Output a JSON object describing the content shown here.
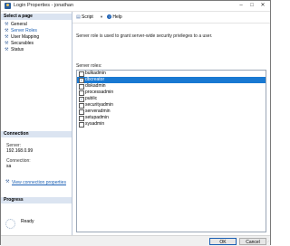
{
  "window": {
    "title": "Login Properties - jonathan"
  },
  "sidebar": {
    "select_page_header": "Select a page",
    "items": [
      {
        "label": "General",
        "icon": "wrench-icon",
        "selected": false
      },
      {
        "label": "Server Roles",
        "icon": "wrench-icon",
        "selected": true
      },
      {
        "label": "User Mapping",
        "icon": "wrench-icon",
        "selected": false
      },
      {
        "label": "Securables",
        "icon": "wrench-icon",
        "selected": false
      },
      {
        "label": "Status",
        "icon": "wrench-icon",
        "selected": false
      }
    ],
    "connection": {
      "header": "Connection",
      "server_label": "Server:",
      "server_value": "192.168.0.99",
      "connection_label": "Connection:",
      "connection_value": "sa",
      "view_link": "View connection properties"
    },
    "progress": {
      "header": "Progress",
      "status": "Ready"
    }
  },
  "toolbar": {
    "script_label": "Script",
    "help_label": "Help"
  },
  "main": {
    "description": "Server role is used to grant server-wide security privileges to a user.",
    "roles_label": "Server roles:",
    "roles": [
      {
        "name": "bulkadmin",
        "checked": false,
        "selected": false
      },
      {
        "name": "dbcreator",
        "checked": true,
        "selected": true
      },
      {
        "name": "diskadmin",
        "checked": false,
        "selected": false
      },
      {
        "name": "processadmin",
        "checked": false,
        "selected": false
      },
      {
        "name": "public",
        "checked": true,
        "selected": false
      },
      {
        "name": "securityadmin",
        "checked": false,
        "selected": false
      },
      {
        "name": "serveradmin",
        "checked": false,
        "selected": false
      },
      {
        "name": "setupadmin",
        "checked": false,
        "selected": false
      },
      {
        "name": "sysadmin",
        "checked": false,
        "selected": false
      }
    ]
  },
  "footer": {
    "ok_label": "OK",
    "cancel_label": "Cancel"
  },
  "colors": {
    "accent": "#1979d2",
    "section_header": "#dbe4f1",
    "link": "#1a5fb4"
  }
}
